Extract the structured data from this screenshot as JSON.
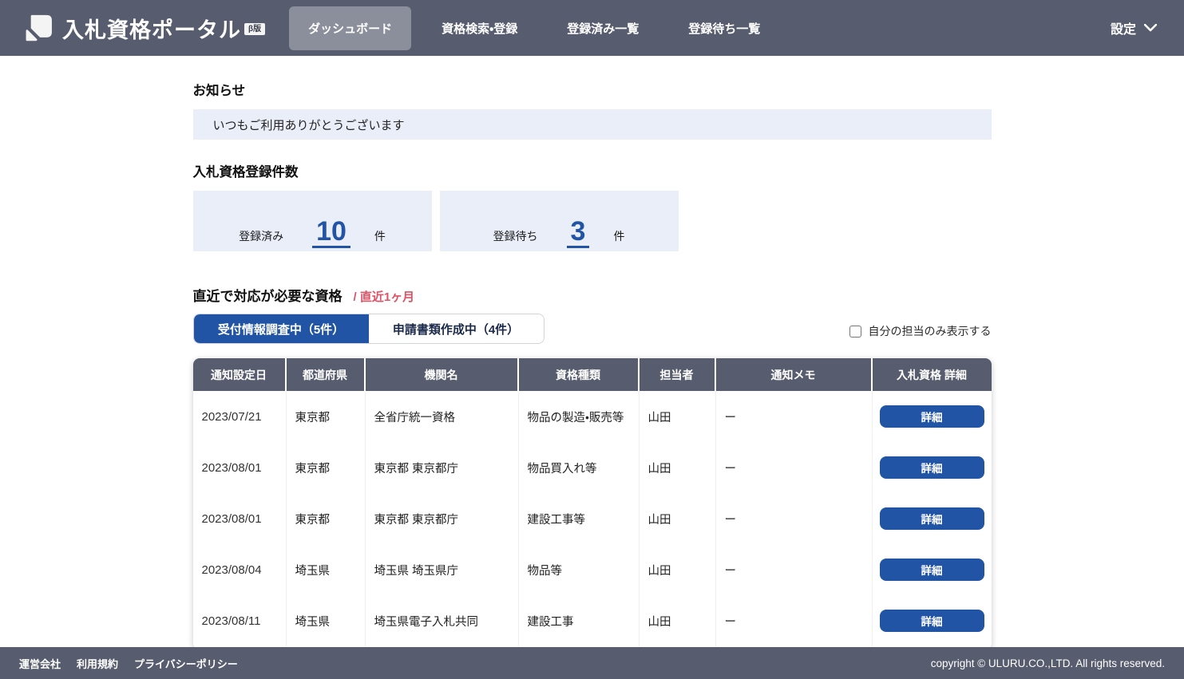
{
  "colors": {
    "header_bg": "#575d6e",
    "active_nav_bg": "#8a8f9b",
    "accent_blue": "#2154a5",
    "light_blue_bg": "#e9eef8",
    "period_red": "#df5266"
  },
  "header": {
    "logo_text": "入札資格ポータル",
    "beta_badge": "β版",
    "nav": [
      {
        "label": "ダッシュボード",
        "active": true
      },
      {
        "label": "資格検索・登録",
        "active": false
      },
      {
        "label": "登録済み一覧",
        "active": false
      },
      {
        "label": "登録待ち一覧",
        "active": false
      }
    ],
    "settings_label": "設定"
  },
  "notice": {
    "heading": "お知らせ",
    "message": "いつもご利用ありがとうございます"
  },
  "counts": {
    "heading": "入札資格登録件数",
    "cards": [
      {
        "label": "登録済み",
        "value": "10",
        "unit": "件"
      },
      {
        "label": "登録待ち",
        "value": "3",
        "unit": "件"
      }
    ]
  },
  "recent": {
    "heading": "直近で対応が必要な資格",
    "period_note": "/ 直近1ヶ月",
    "tabs": [
      {
        "label": "受付情報調査中（5件）",
        "active": true
      },
      {
        "label": "申請書類作成中（4件）",
        "active": false
      }
    ],
    "filter_checkbox_label": "自分の担当のみ表示する",
    "table": {
      "columns": [
        "通知設定日",
        "都道府県",
        "機関名",
        "資格種類",
        "担当者",
        "通知メモ",
        "入札資格 詳細"
      ],
      "detail_button_label": "詳細",
      "rows": [
        [
          "2023/07/21",
          "東京都",
          "全省庁統一資格",
          "物品の製造・販売等",
          "山田",
          "ー"
        ],
        [
          "2023/08/01",
          "東京都",
          "東京都 東京都庁",
          "物品買入れ等",
          "山田",
          "ー"
        ],
        [
          "2023/08/01",
          "東京都",
          "東京都 東京都庁",
          "建設工事等",
          "山田",
          "ー"
        ],
        [
          "2023/08/04",
          "埼玉県",
          "埼玉県 埼玉県庁",
          "物品等",
          "山田",
          "ー"
        ],
        [
          "2023/08/11",
          "埼玉県",
          "埼玉県電子入札共同",
          "建設工事",
          "山田",
          "ー"
        ]
      ]
    }
  },
  "footer": {
    "links": [
      "運営会社",
      "利用規約",
      "プライバシーポリシー"
    ],
    "copyright": "copyright © ULURU.CO.,LTD. All rights reserved."
  }
}
